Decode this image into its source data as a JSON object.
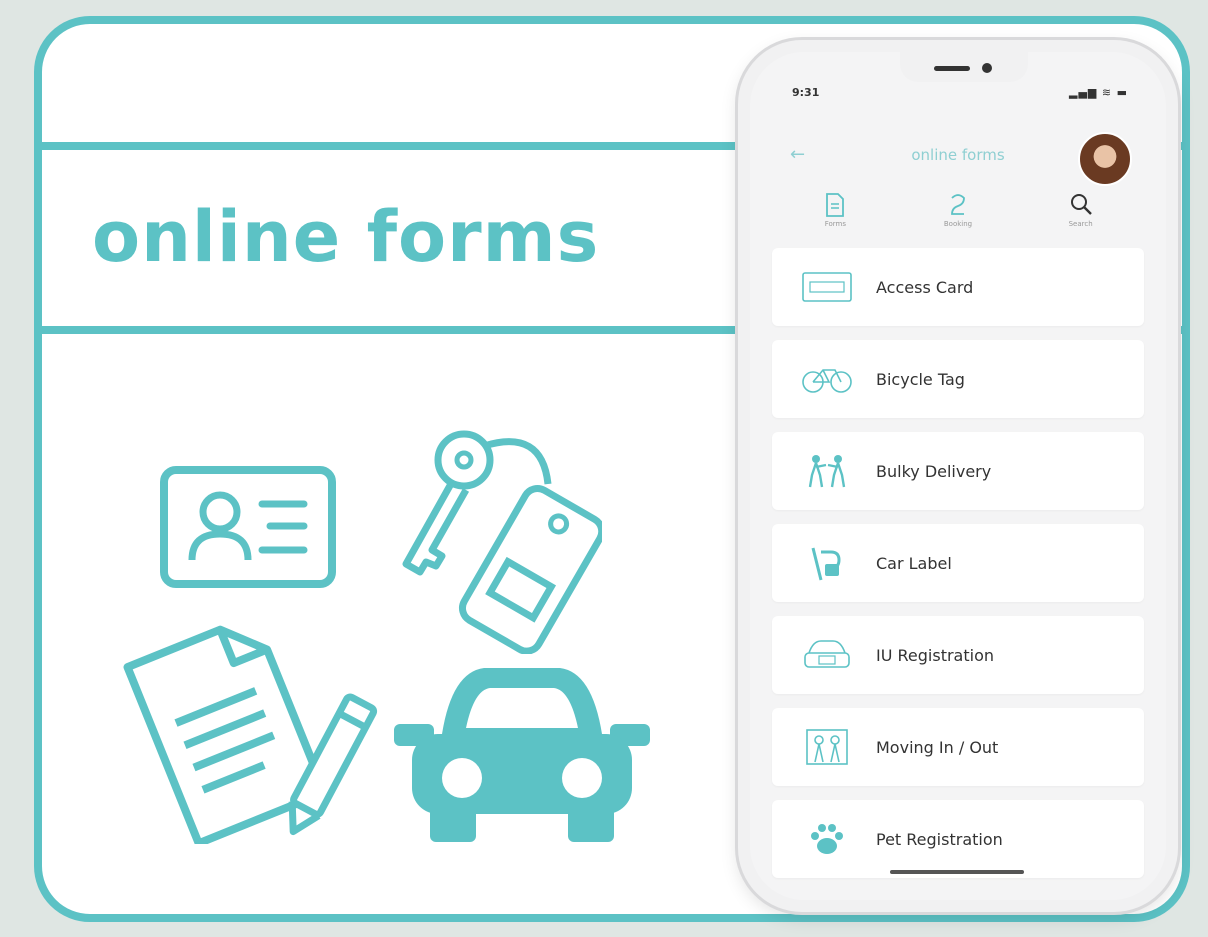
{
  "theme": {
    "teal": "#5cc2c5",
    "background": "#dfe6e3",
    "card": "#ffffff"
  },
  "hero": {
    "title": "online forms"
  },
  "illustrations": [
    "id-card-icon",
    "key-tag-icon",
    "document-pencil-icon",
    "car-icon"
  ],
  "phone": {
    "status": {
      "time": "9:31",
      "icons": "▂▄▆ ≋ ▬"
    },
    "nav": {
      "back": "←",
      "title": "online forms"
    },
    "toolbar": [
      {
        "icon": "forms-icon",
        "label": "Forms"
      },
      {
        "icon": "booking-icon",
        "label": "Booking"
      },
      {
        "icon": "search-icon",
        "label": "Search"
      }
    ],
    "forms": [
      {
        "label": "Access Card",
        "icon": "access-card-icon"
      },
      {
        "label": "Bicycle Tag",
        "icon": "bicycle-icon"
      },
      {
        "label": "Bulky Delivery",
        "icon": "movers-icon"
      },
      {
        "label": "Car Label",
        "icon": "car-label-icon"
      },
      {
        "label": "IU Registration",
        "icon": "iu-device-icon"
      },
      {
        "label": "Moving In / Out",
        "icon": "moving-icon"
      },
      {
        "label": "Pet Registration",
        "icon": "paw-icon"
      }
    ]
  }
}
